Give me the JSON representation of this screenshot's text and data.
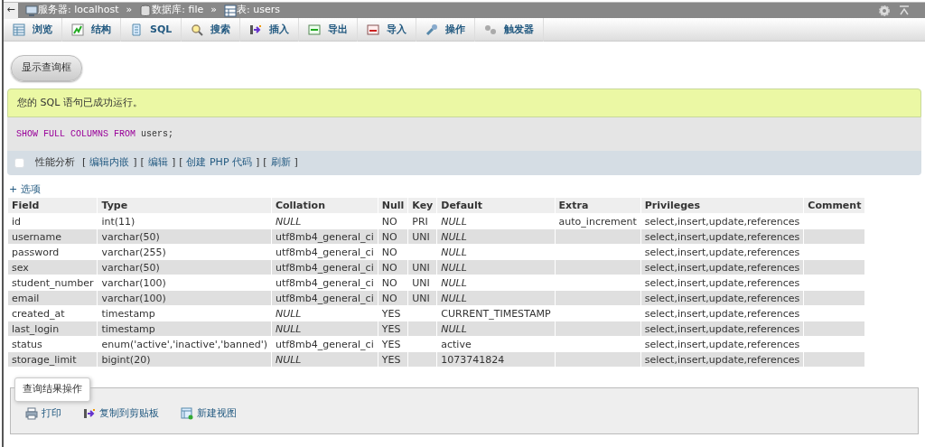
{
  "breadcrumb": {
    "back": "←",
    "items": [
      {
        "label": "服务器:",
        "value": "localhost"
      },
      {
        "label": "数据库:",
        "value": "file"
      },
      {
        "label": "表:",
        "value": "users"
      }
    ],
    "separator": "»"
  },
  "tabs": [
    {
      "label": "浏览"
    },
    {
      "label": "结构"
    },
    {
      "label": "SQL"
    },
    {
      "label": "搜索"
    },
    {
      "label": "插入"
    },
    {
      "label": "导出"
    },
    {
      "label": "导入"
    },
    {
      "label": "操作"
    },
    {
      "label": "触发器"
    }
  ],
  "show_query_button": "显示查询框",
  "message": "您的 SQL 语句已成功运行。",
  "sql": {
    "keywords": "SHOW FULL COLUMNS FROM",
    "rest": "users;"
  },
  "query_links": {
    "profiling_label": "性能分析",
    "profiling_checked": false,
    "links": [
      "编辑内嵌",
      "编辑",
      "创建 PHP 代码",
      "刷新"
    ],
    "open_bracket": "[",
    "close_bracket": "]"
  },
  "options_link": "+ 选项",
  "table": {
    "columns": [
      "Field",
      "Type",
      "Collation",
      "Null",
      "Key",
      "Default",
      "Extra",
      "Privileges",
      "Comment"
    ],
    "rows": [
      {
        "cells": [
          "id",
          "int(11)",
          {
            "text": "NULL",
            "is_null": true
          },
          "NO",
          "PRI",
          {
            "text": "NULL",
            "is_null": true
          },
          "auto_increment",
          "select,insert,update,references",
          null
        ]
      },
      {
        "cells": [
          "username",
          "varchar(50)",
          "utf8mb4_general_ci",
          "NO",
          "UNI",
          {
            "text": "NULL",
            "is_null": true
          },
          null,
          "select,insert,update,references",
          null
        ]
      },
      {
        "cells": [
          "password",
          "varchar(255)",
          "utf8mb4_general_ci",
          "NO",
          null,
          {
            "text": "NULL",
            "is_null": true
          },
          null,
          "select,insert,update,references",
          null
        ]
      },
      {
        "cells": [
          "sex",
          "varchar(50)",
          "utf8mb4_general_ci",
          "NO",
          "UNI",
          {
            "text": "NULL",
            "is_null": true
          },
          null,
          "select,insert,update,references",
          null
        ]
      },
      {
        "cells": [
          "student_number",
          "varchar(100)",
          "utf8mb4_general_ci",
          "NO",
          "UNI",
          {
            "text": "NULL",
            "is_null": true
          },
          null,
          "select,insert,update,references",
          null
        ]
      },
      {
        "cells": [
          "email",
          "varchar(100)",
          "utf8mb4_general_ci",
          "NO",
          "UNI",
          {
            "text": "NULL",
            "is_null": true
          },
          null,
          "select,insert,update,references",
          null
        ]
      },
      {
        "cells": [
          "created_at",
          "timestamp",
          {
            "text": "NULL",
            "is_null": true
          },
          "YES",
          null,
          "CURRENT_TIMESTAMP",
          null,
          "select,insert,update,references",
          null
        ]
      },
      {
        "cells": [
          "last_login",
          "timestamp",
          {
            "text": "NULL",
            "is_null": true
          },
          "YES",
          null,
          {
            "text": "NULL",
            "is_null": true
          },
          null,
          "select,insert,update,references",
          null
        ]
      },
      {
        "cells": [
          "status",
          "enum('active','inactive','banned')",
          "utf8mb4_general_ci",
          "YES",
          null,
          "active",
          null,
          "select,insert,update,references",
          null
        ]
      },
      {
        "cells": [
          "storage_limit",
          "bigint(20)",
          {
            "text": "NULL",
            "is_null": true
          },
          "YES",
          null,
          "1073741824",
          null,
          "select,insert,update,references",
          null
        ]
      }
    ]
  },
  "result_operations": {
    "legend": "查询结果操作",
    "actions": [
      {
        "label": "打印"
      },
      {
        "label": "复制到剪贴板"
      },
      {
        "label": "新建视图"
      }
    ]
  }
}
